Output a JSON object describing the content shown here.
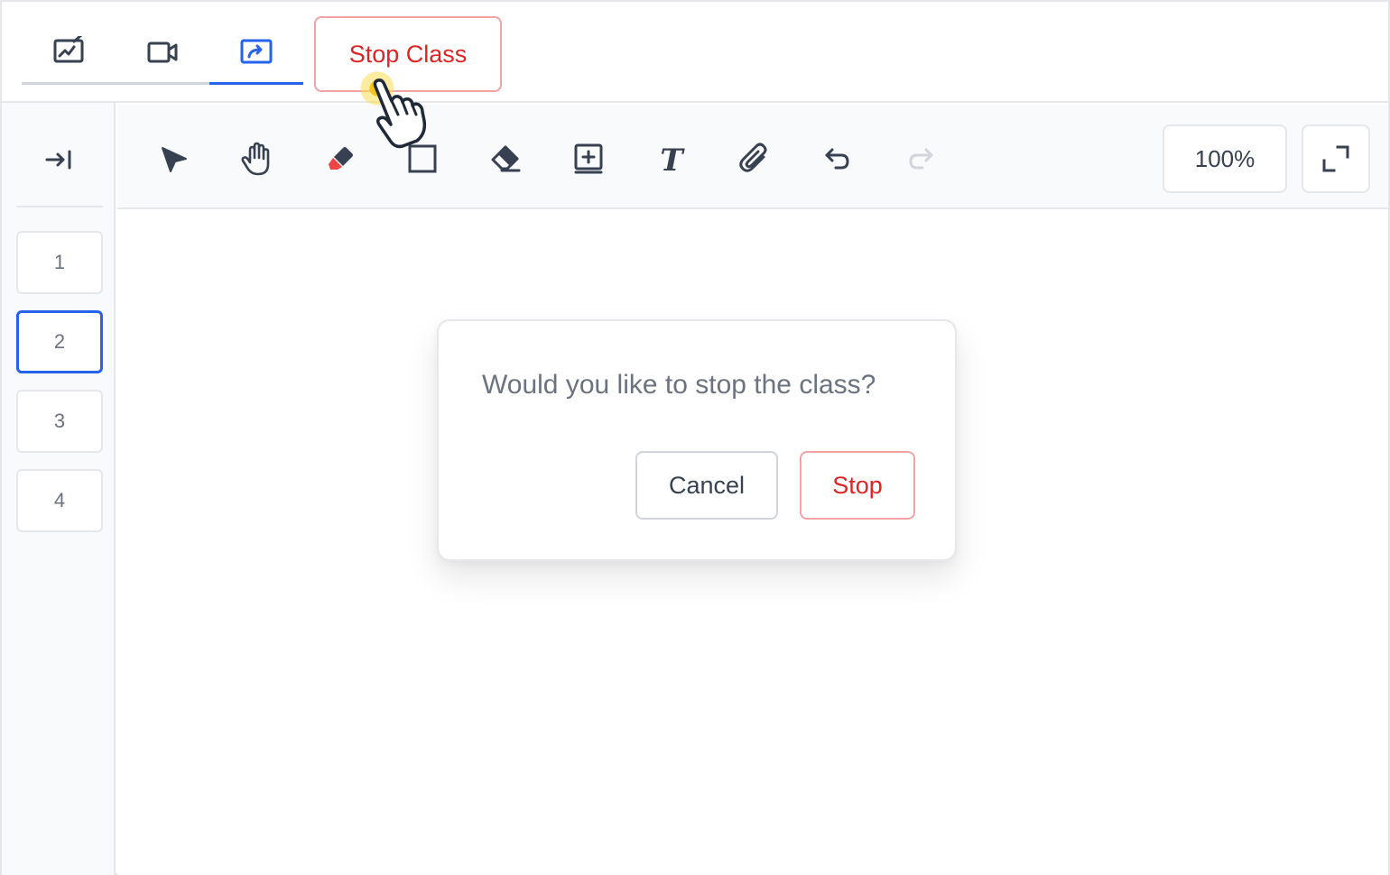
{
  "header": {
    "tabs": [
      {
        "name": "whiteboard",
        "icon": "whiteboard-chart-icon",
        "active": false
      },
      {
        "name": "video",
        "icon": "video-camera-icon",
        "active": false
      },
      {
        "name": "screen-share",
        "icon": "screen-share-icon",
        "active": true
      }
    ],
    "stop_class_label": "Stop Class"
  },
  "sidebar": {
    "collapse_icon": "arrow-right-to-line-icon",
    "pages": [
      "1",
      "2",
      "3",
      "4"
    ],
    "active_page": "2"
  },
  "toolbar": {
    "tools": [
      "select-arrow-icon",
      "hand-pan-icon",
      "highlighter-icon",
      "rectangle-icon",
      "eraser-icon",
      "add-frame-icon",
      "text-tool-icon",
      "attachment-icon",
      "undo-icon",
      "redo-icon"
    ],
    "zoom_label": "100%",
    "fullscreen_icon": "expand-icon"
  },
  "dialog": {
    "message": "Would you like to stop the class?",
    "cancel_label": "Cancel",
    "stop_label": "Stop"
  },
  "colors": {
    "accent": "#2563eb",
    "danger": "#dc2626",
    "danger_border": "#f3a3a3",
    "border": "#e5e7eb",
    "icon": "#374151"
  }
}
